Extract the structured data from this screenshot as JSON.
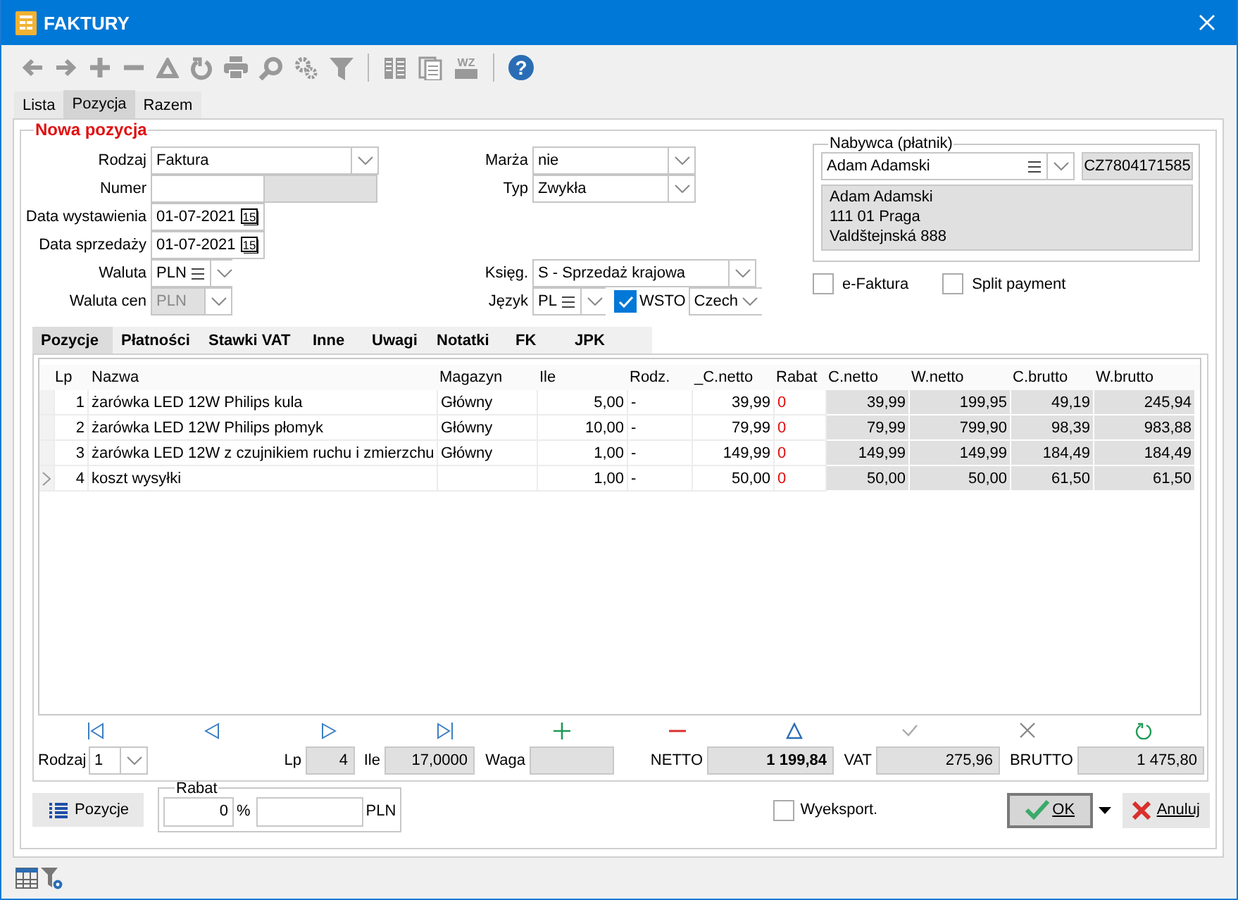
{
  "window": {
    "title": "FAKTURY"
  },
  "toolbar": {
    "wz_label": "WZ",
    "help_label": "?"
  },
  "top_tabs": [
    {
      "label": "Lista",
      "selected": false
    },
    {
      "label": "Pozycja",
      "selected": true
    },
    {
      "label": "Razem",
      "selected": false
    }
  ],
  "group": {
    "legend": "Nowa pozycja"
  },
  "left_fields": [
    {
      "label": "Rodzaj",
      "kind": "combo",
      "value": "Faktura",
      "disabled": false
    },
    {
      "label": "Numer",
      "kind": "number",
      "disabled": false
    },
    {
      "label": "Data wystawienia",
      "kind": "date",
      "value": "01-07-2021",
      "calendar_day": "15",
      "disabled": false
    },
    {
      "label": "Data sprzedaży",
      "kind": "date",
      "value": "01-07-2021",
      "calendar_day": "15",
      "disabled": false
    },
    {
      "label": "Waluta",
      "kind": "lookup",
      "value": "PLN",
      "disabled": false
    },
    {
      "label": "Waluta cen",
      "kind": "lookup",
      "value": "PLN",
      "disabled": true
    }
  ],
  "middle_fields": [
    {
      "label": "Marża",
      "kind": "combo",
      "value": "nie"
    },
    {
      "label": "Typ",
      "kind": "combo",
      "value": "Zwykła"
    },
    {
      "label": "Księg.",
      "kind": "combo",
      "value": "S - Sprzedaż krajowa"
    },
    {
      "label": "Język",
      "kind": "lookup",
      "value": "PL",
      "option": {
        "label": "WSTO",
        "checked": true
      },
      "extra": "Czech"
    }
  ],
  "buyer": {
    "legend": "Nabywca (płatnik)",
    "name": "Adam Adamski",
    "tax_id": "CZ7804171585",
    "address": [
      "Adam Adamski",
      "111 01 Praga",
      "Valdštejnská 888"
    ]
  },
  "options": [
    {
      "label": "e-Faktura",
      "checked": false
    },
    {
      "label": "Split payment",
      "checked": false
    }
  ],
  "inner_tabs": [
    {
      "label": "Pozycje",
      "selected": true
    },
    {
      "label": "Płatności",
      "selected": false
    },
    {
      "label": "Stawki VAT",
      "selected": false
    },
    {
      "label": "Inne",
      "selected": false
    },
    {
      "label": "Uwagi",
      "selected": false
    },
    {
      "label": "Notatki",
      "selected": false
    },
    {
      "label": "FK",
      "selected": false
    },
    {
      "label": "JPK",
      "selected": false
    }
  ],
  "table": {
    "columns": [
      {
        "label": "Lp",
        "kind": "number"
      },
      {
        "label": "Nazwa",
        "kind": "text"
      },
      {
        "label": "Magazyn",
        "kind": "text"
      },
      {
        "label": "Ile",
        "kind": "number"
      },
      {
        "label": "Rodz.",
        "kind": "text"
      },
      {
        "label": "_C.netto",
        "kind": "number"
      },
      {
        "label": "Rabat",
        "kind": "discount"
      },
      {
        "label": "C.netto",
        "kind": "computed"
      },
      {
        "label": "W.netto",
        "kind": "computed"
      },
      {
        "label": "C.brutto",
        "kind": "computed"
      },
      {
        "label": "W.brutto",
        "kind": "computed"
      }
    ],
    "rows": [
      {
        "current": false,
        "cells": [
          "1",
          "żarówka LED 12W Philips kula",
          "Główny",
          "5,00",
          "-",
          "39,99",
          "0",
          "39,99",
          "199,95",
          "49,19",
          "245,94"
        ]
      },
      {
        "current": false,
        "cells": [
          "2",
          "żarówka LED 12W Philips płomyk",
          "Główny",
          "10,00",
          "-",
          "79,99",
          "0",
          "79,99",
          "799,90",
          "98,39",
          "983,88"
        ]
      },
      {
        "current": false,
        "cells": [
          "3",
          "żarówka LED 12W z czujnikiem ruchu i zmierzchu",
          "Główny",
          "1,00",
          "-",
          "149,99",
          "0",
          "149,99",
          "149,99",
          "184,49",
          "184,49"
        ]
      },
      {
        "current": true,
        "cells": [
          "4",
          "koszt wysyłki",
          null,
          "1,00",
          "-",
          "50,00",
          "0",
          "50,00",
          "50,00",
          "61,50",
          "61,50"
        ]
      }
    ]
  },
  "footer": [
    {
      "label": "Rodzaj",
      "kind": "combo",
      "value": "1",
      "emphasis": false
    },
    {
      "label": "Lp",
      "kind": "readonly",
      "value": "4",
      "emphasis": false
    },
    {
      "label": "Ile",
      "kind": "readonly",
      "value": "17,0000",
      "emphasis": false
    },
    {
      "label": "Waga",
      "kind": "readonly"
    },
    {
      "label": "NETTO",
      "kind": "readonly",
      "value": "1 199,84",
      "emphasis": true
    },
    {
      "label": "VAT",
      "kind": "readonly",
      "value": "275,96",
      "emphasis": false
    },
    {
      "label": "BRUTTO",
      "kind": "readonly",
      "value": "1 475,80",
      "emphasis": false
    }
  ],
  "bottom": {
    "list_button": "Pozycje",
    "discount": {
      "legend": "Rabat",
      "percent": "0",
      "percent_unit": "%",
      "amount_unit": "PLN"
    },
    "export": {
      "label": "Wyeksport.",
      "checked": false
    },
    "ok": "OK",
    "cancel": "Anuluj"
  }
}
